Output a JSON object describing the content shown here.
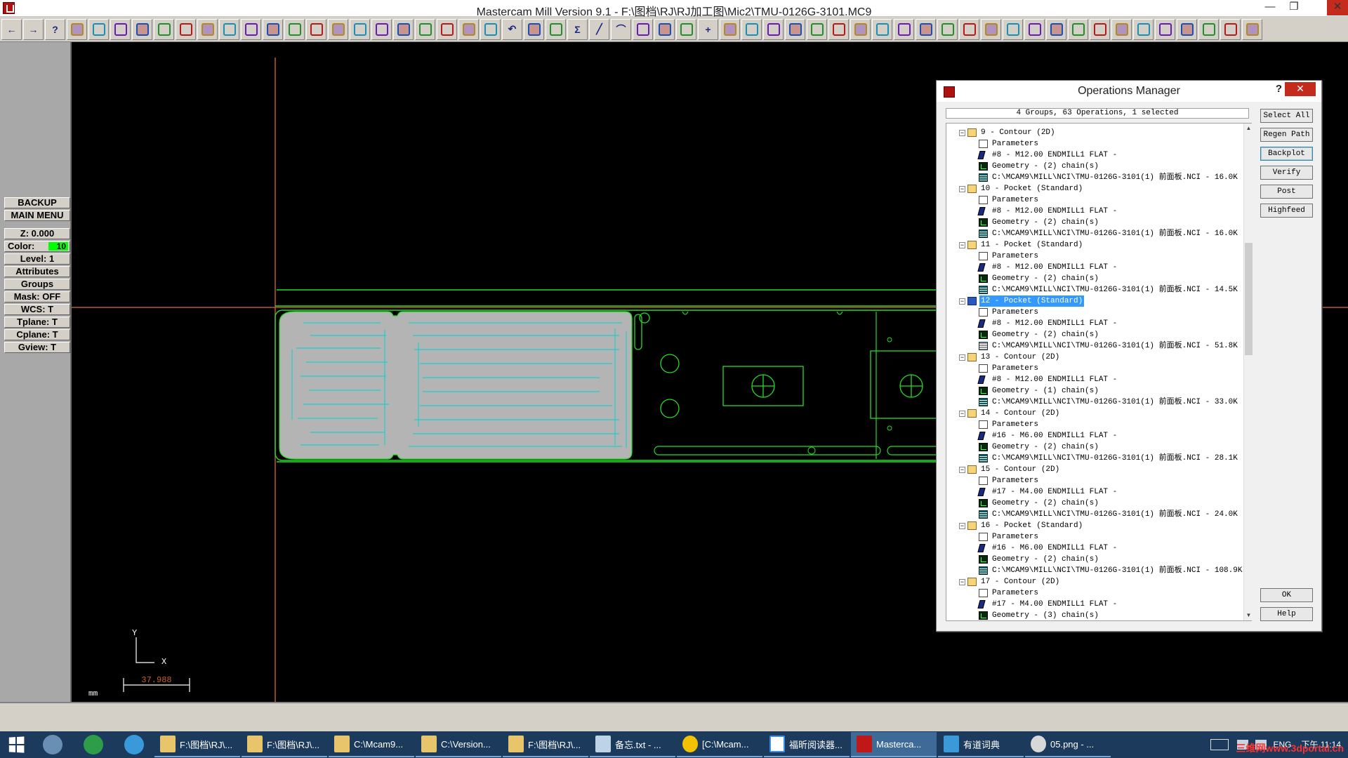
{
  "window": {
    "title": "Mastercam Mill Version 9.1 - F:\\图档\\RJ\\RJ加工图\\Mic2\\TMU-0126G-3101.MC9",
    "min_glyph": "—",
    "max_glyph": "❐",
    "close_glyph": "✕"
  },
  "toolbar": {
    "icons": [
      "back-arrow-icon",
      "forward-arrow-icon",
      "help-icon",
      "file-list-icon",
      "what-is-icon",
      "zoom-window-icon",
      "zoom-in-icon",
      "zoom-out-icon",
      "pan-icon",
      "select-icon",
      "shade-icon",
      "cube-top-icon",
      "cube-front-icon",
      "cube-side-icon",
      "cube-iso-icon",
      "view-top-icon",
      "view-front-icon",
      "view-side-icon",
      "view-iso-icon",
      "eraser-icon",
      "no-entry-icon",
      "transform-icon",
      "translate-icon",
      "undo-icon",
      "sphere-icon",
      "group-icon",
      "sigma-icon",
      "line-icon",
      "arc-icon",
      "fillet-icon",
      "spline-icon",
      "rectangle-icon",
      "point-icon",
      "surface-icon",
      "solid-icon",
      "levels-icon",
      "trim-icon",
      "break-icon",
      "extend-icon",
      "join-icon",
      "modify-icon",
      "mirror-icon",
      "rotate-icon",
      "offset-icon",
      "scale-icon",
      "array-icon",
      "grid-icon",
      "xyz-icon",
      "dimension-icon",
      "screen-icon",
      "tool-library-icon",
      "toolpath-icon",
      "pocket-icon",
      "drill-icon",
      "surface-rough-icon",
      "surface-finish-icon",
      "tree-icon",
      "exit-icon"
    ],
    "symbols": {
      "back-arrow-icon": "←",
      "forward-arrow-icon": "→",
      "help-icon": "?",
      "sigma-icon": "Σ",
      "point-icon": "+",
      "undo-icon": "↶",
      "line-icon": "╱",
      "arc-icon": "⌒"
    }
  },
  "left_panel": {
    "backup": "BACKUP",
    "main_menu": "MAIN MENU",
    "z": "Z:  0.000",
    "color_label": "Color:",
    "color_value": "10",
    "level": "Level:  1",
    "attributes": "Attributes",
    "groups": "Groups",
    "mask": "Mask:  OFF",
    "wcs": "WCS:  T",
    "tplane": "Tplane:  T",
    "cplane": "Cplane:  T",
    "gview": "Gview:  T"
  },
  "graphics": {
    "unit": "mm",
    "axis_y": "Y",
    "axis_x": "X",
    "scale_value": "37.988",
    "colors": {
      "crosshair": "#b85c2a",
      "geometry": "#22dd22",
      "toolpath": "#22cccc",
      "pocket_fill": "#b4b4b4"
    }
  },
  "operations_manager": {
    "title": "Operations Manager",
    "help": "?",
    "close": "✕",
    "status": "4 Groups, 63 Operations, 1 selected",
    "buttons": {
      "select_all": "Select All",
      "regen_path": "Regen Path",
      "backplot": "Backplot",
      "verify": "Verify",
      "post": "Post",
      "highfeed": "Highfeed",
      "ok": "OK",
      "help": "Help"
    },
    "rows": [
      {
        "kind": "op",
        "text": "9 - Contour (2D)"
      },
      {
        "kind": "params",
        "text": "Parameters"
      },
      {
        "kind": "tool",
        "text": "#8 - M12.00 ENDMILL1 FLAT -"
      },
      {
        "kind": "geom",
        "text": "Geometry - (2) chain(s)"
      },
      {
        "kind": "nci",
        "text": "C:\\MCAM9\\MILL\\NCI\\TMU-0126G-3101(1) 前面板.NCI - 16.0K"
      },
      {
        "kind": "op",
        "text": "10 - Pocket (Standard)"
      },
      {
        "kind": "params",
        "text": "Parameters"
      },
      {
        "kind": "tool",
        "text": "#8 - M12.00 ENDMILL1 FLAT -"
      },
      {
        "kind": "geom",
        "text": "Geometry - (2) chain(s)"
      },
      {
        "kind": "nci",
        "text": "C:\\MCAM9\\MILL\\NCI\\TMU-0126G-3101(1) 前面板.NCI - 16.0K"
      },
      {
        "kind": "op",
        "text": "11 - Pocket (Standard)"
      },
      {
        "kind": "params",
        "text": "Parameters"
      },
      {
        "kind": "tool",
        "text": "#8 - M12.00 ENDMILL1 FLAT -"
      },
      {
        "kind": "geom",
        "text": "Geometry - (2) chain(s)"
      },
      {
        "kind": "nci",
        "text": "C:\\MCAM9\\MILL\\NCI\\TMU-0126G-3101(1) 前面板.NCI - 14.5K"
      },
      {
        "kind": "op",
        "text": "12 - Pocket (Standard)",
        "selected": true
      },
      {
        "kind": "params",
        "text": "Parameters"
      },
      {
        "kind": "tool",
        "text": "#8 - M12.00 ENDMILL1 FLAT -"
      },
      {
        "kind": "geom",
        "text": "Geometry - (2) chain(s)"
      },
      {
        "kind": "nci",
        "text": "C:\\MCAM9\\MILL\\NCI\\TMU-0126G-3101(1) 前面板.NCI - 51.8K",
        "dirty": true
      },
      {
        "kind": "op",
        "text": "13 - Contour (2D)"
      },
      {
        "kind": "params",
        "text": "Parameters"
      },
      {
        "kind": "tool",
        "text": "#8 - M12.00 ENDMILL1 FLAT -"
      },
      {
        "kind": "geom",
        "text": "Geometry - (1) chain(s)"
      },
      {
        "kind": "nci",
        "text": "C:\\MCAM9\\MILL\\NCI\\TMU-0126G-3101(1) 前面板.NCI - 33.0K"
      },
      {
        "kind": "op",
        "text": "14 - Contour (2D)"
      },
      {
        "kind": "params",
        "text": "Parameters"
      },
      {
        "kind": "tool",
        "text": "#16 - M6.00 ENDMILL1 FLAT -"
      },
      {
        "kind": "geom",
        "text": "Geometry - (2) chain(s)"
      },
      {
        "kind": "nci",
        "text": "C:\\MCAM9\\MILL\\NCI\\TMU-0126G-3101(1) 前面板.NCI - 28.1K"
      },
      {
        "kind": "op",
        "text": "15 - Contour (2D)"
      },
      {
        "kind": "params",
        "text": "Parameters"
      },
      {
        "kind": "tool",
        "text": "#17 - M4.00 ENDMILL1 FLAT -"
      },
      {
        "kind": "geom",
        "text": "Geometry - (2) chain(s)"
      },
      {
        "kind": "nci",
        "text": "C:\\MCAM9\\MILL\\NCI\\TMU-0126G-3101(1) 前面板.NCI - 24.0K"
      },
      {
        "kind": "op",
        "text": "16 - Pocket (Standard)"
      },
      {
        "kind": "params",
        "text": "Parameters"
      },
      {
        "kind": "tool",
        "text": "#16 - M6.00 ENDMILL1 FLAT -"
      },
      {
        "kind": "geom",
        "text": "Geometry - (2) chain(s)"
      },
      {
        "kind": "nci",
        "text": "C:\\MCAM9\\MILL\\NCI\\TMU-0126G-3101(1) 前面板.NCI - 108.9K"
      },
      {
        "kind": "op",
        "text": "17 - Contour (2D)"
      },
      {
        "kind": "params",
        "text": "Parameters"
      },
      {
        "kind": "tool",
        "text": "#17 - M4.00 ENDMILL1 FLAT -"
      },
      {
        "kind": "geom",
        "text": "Geometry - (3) chain(s)"
      }
    ]
  },
  "taskbar": {
    "pinned": [
      {
        "name": "pinned-file-explorer-icon",
        "color": "#6a8fb5"
      },
      {
        "name": "pinned-chrome-icon",
        "color": "#2e9d4a"
      },
      {
        "name": "pinned-dict-icon",
        "color": "#3a9ad9"
      }
    ],
    "tasks": [
      {
        "label": "F:\\图档\\RJ\\...",
        "icon": "folder",
        "name": "task-folder-1"
      },
      {
        "label": "F:\\图档\\RJ\\...",
        "icon": "folder",
        "name": "task-folder-2"
      },
      {
        "label": "C:\\Mcam9...",
        "icon": "folder",
        "name": "task-folder-3"
      },
      {
        "label": "C:\\Version...",
        "icon": "folder",
        "name": "task-folder-4"
      },
      {
        "label": "F:\\图档\\RJ\\...",
        "icon": "folder",
        "name": "task-folder-5"
      },
      {
        "label": "备忘.txt - ...",
        "icon": "doc",
        "name": "task-notepad"
      },
      {
        "label": "[C:\\Mcam...",
        "icon": "ue",
        "name": "task-ultraedit"
      },
      {
        "label": "福昕阅读器...",
        "icon": "pdf",
        "name": "task-foxit"
      },
      {
        "label": "Masterca...",
        "icon": "mc",
        "name": "task-mastercam",
        "active": true
      },
      {
        "label": "有道词典",
        "icon": "dict",
        "name": "task-youdao"
      },
      {
        "label": "05.png - ...",
        "icon": "img",
        "name": "task-image-viewer"
      }
    ],
    "lang": "ENG",
    "clock": "下午 11:14",
    "watermark": "三维网www.3dportal.cn"
  }
}
